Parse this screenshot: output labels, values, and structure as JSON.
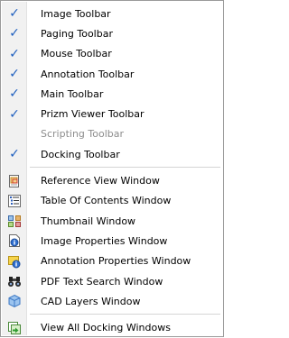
{
  "menu": {
    "toolbars": [
      {
        "label": "Image Toolbar",
        "checked": true
      },
      {
        "label": "Paging Toolbar",
        "checked": true
      },
      {
        "label": "Mouse Toolbar",
        "checked": true
      },
      {
        "label": "Annotation Toolbar",
        "checked": true
      },
      {
        "label": "Main Toolbar",
        "checked": true
      },
      {
        "label": "Prizm Viewer Toolbar",
        "checked": true
      },
      {
        "label": "Scripting Toolbar",
        "checked": false,
        "disabled": true
      },
      {
        "label": "Docking Toolbar",
        "checked": true
      }
    ],
    "windows": [
      {
        "label": "Reference View Window",
        "icon": "reference-view-icon"
      },
      {
        "label": "Table Of Contents Window",
        "icon": "table-of-contents-icon"
      },
      {
        "label": "Thumbnail Window",
        "icon": "thumbnail-icon"
      },
      {
        "label": "Image Properties Window",
        "icon": "image-properties-icon"
      },
      {
        "label": "Annotation Properties Window",
        "icon": "annotation-properties-icon"
      },
      {
        "label": "PDF Text Search Window",
        "icon": "binoculars-icon"
      },
      {
        "label": "CAD Layers Window",
        "icon": "cad-layers-icon"
      }
    ],
    "view_all": {
      "label": "View All Docking Windows",
      "icon": "view-all-windows-icon"
    },
    "colors": {
      "check": "#1e5fbf",
      "disabled_text": "#8d8d8d",
      "gutter": "#f1f1f1"
    }
  }
}
